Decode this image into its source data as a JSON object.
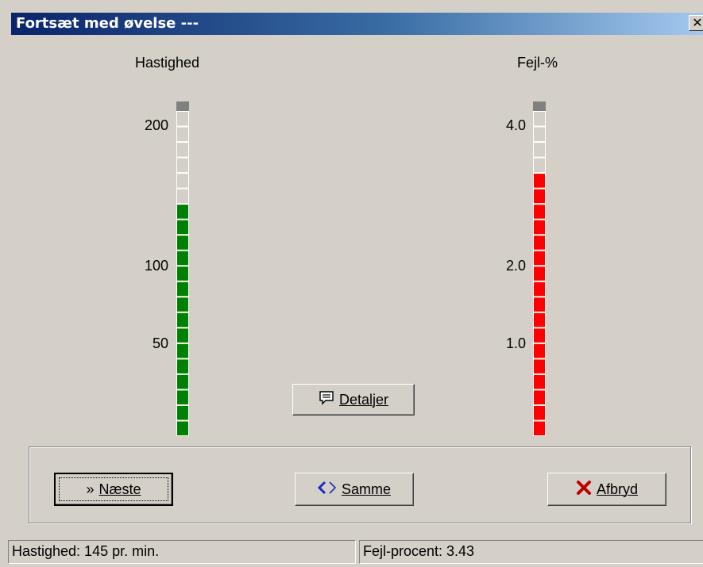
{
  "window": {
    "title": "Fortsæt med øvelse ---",
    "close_glyph": "✕"
  },
  "speed_gauge": {
    "title": "Hastighed",
    "scale_labels": [
      "200",
      "100",
      "50"
    ],
    "segments_total": 21,
    "segments_lit": 15,
    "lit_color": "#008000"
  },
  "error_gauge": {
    "title": "Fejl-%",
    "scale_labels": [
      "4.0",
      "2.0",
      "1.0"
    ],
    "segments_total": 21,
    "segments_lit": 17,
    "lit_color": "#ff0000"
  },
  "buttons": {
    "details": {
      "label": "Detaljer",
      "icon": "comment-icon"
    },
    "next": {
      "label": "Næste",
      "icon": "double-chevron-right-icon",
      "glyph": "»"
    },
    "same": {
      "label": "Samme",
      "icon": "repeat-icon"
    },
    "cancel": {
      "label": "Afbryd",
      "icon": "red-x-icon"
    }
  },
  "statusbar": {
    "speed_text": "Hastighed: 145 pr. min.",
    "error_text": "Fejl-procent: 3.43"
  }
}
